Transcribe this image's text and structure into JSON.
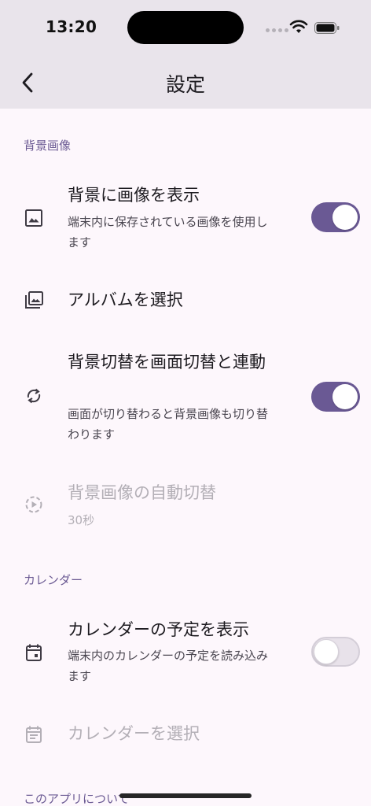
{
  "status_bar": {
    "time": "13:20"
  },
  "app_bar": {
    "title": "設定"
  },
  "sections": {
    "background": {
      "header": "背景画像",
      "show_image": {
        "title": "背景に画像を表示",
        "subtitle": "端末内に保存されている画像を使用します",
        "enabled": true
      },
      "select_album": {
        "title": "アルバムを選択"
      },
      "link_switch": {
        "title": "背景切替を画面切替と連動",
        "subtitle": "画面が切り替わると背景画像も切り替わります",
        "enabled": true
      },
      "auto_switch": {
        "title": "背景画像の自動切替",
        "subtitle": "30秒"
      }
    },
    "calendar": {
      "header": "カレンダー",
      "show_events": {
        "title": "カレンダーの予定を表示",
        "subtitle": "端末内のカレンダーの予定を読み込みます",
        "enabled": false
      },
      "select_calendar": {
        "title": "カレンダーを選択"
      }
    },
    "about": {
      "header": "このアプリについて"
    }
  },
  "colors": {
    "accent": "#6a5994",
    "header_bg": "#e9e4eb",
    "page_bg": "#fdf7fc",
    "disabled_text": "#b3afb6"
  }
}
